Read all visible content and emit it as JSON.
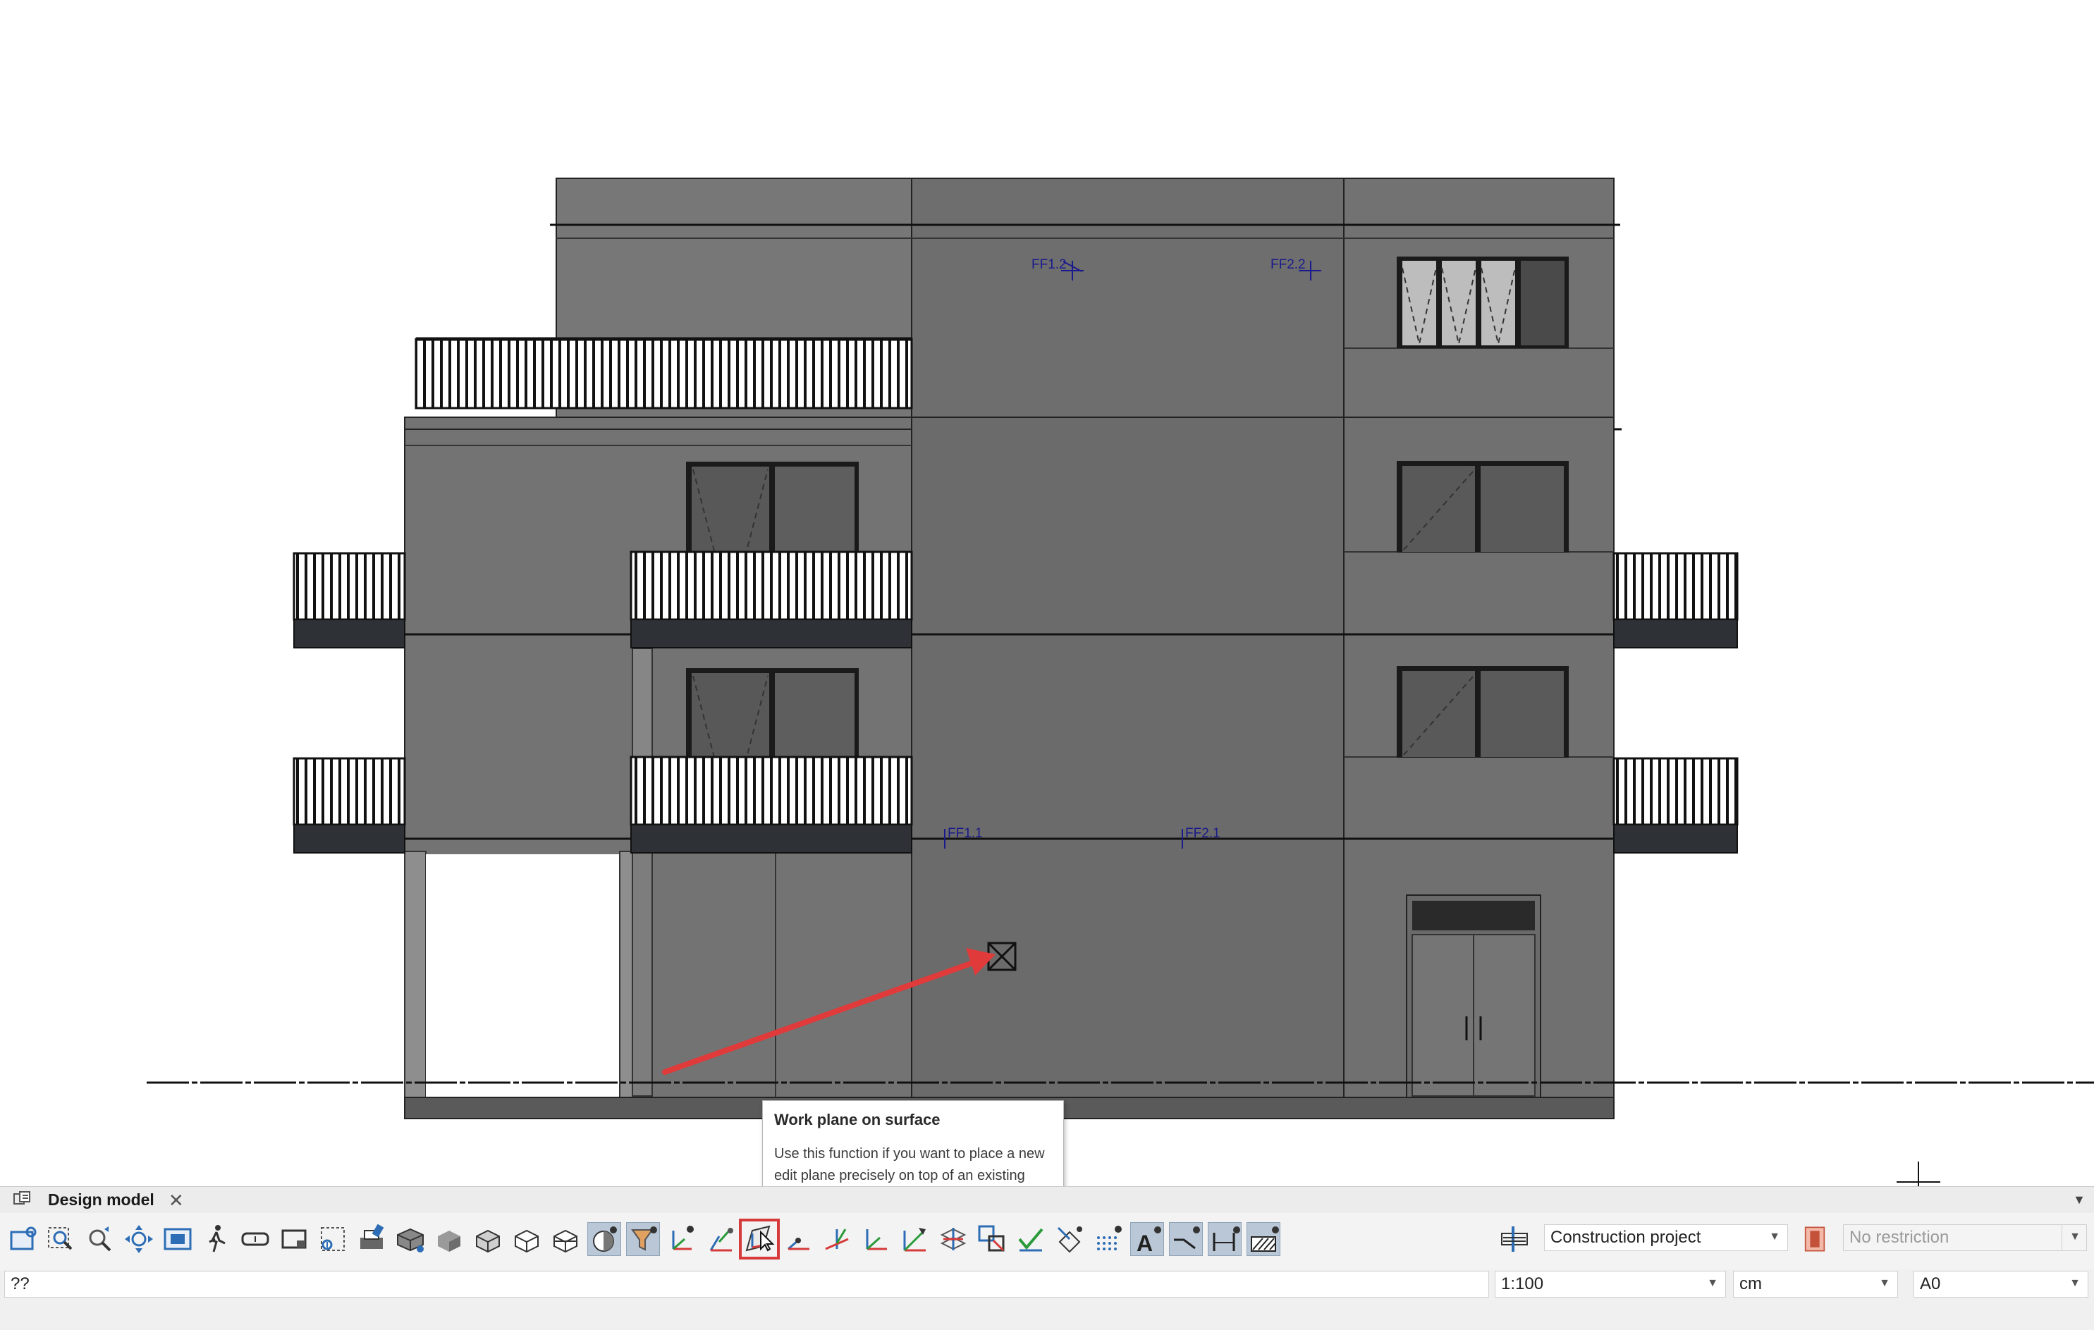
{
  "drawing": {
    "level_labels": [
      "FF1.2",
      "FF2.2",
      "FF1.1",
      "FF2.1"
    ]
  },
  "tooltip": {
    "title": "Work plane on surface",
    "body": "Use this function if you want to place a new edit plane precisely on top of an existing surface."
  },
  "tab": {
    "label": "Design model",
    "close": "✕"
  },
  "toolbar": {
    "project_combo": "Construction project",
    "restriction_combo": "No restriction"
  },
  "status": {
    "input_text": "??",
    "scale": "1:100",
    "unit": "cm",
    "paper": "A0"
  },
  "colors": {
    "annotation_arrow": "#e03a3a",
    "highlight_box": "#d63a3a",
    "level_label": "#1a1a8c"
  }
}
